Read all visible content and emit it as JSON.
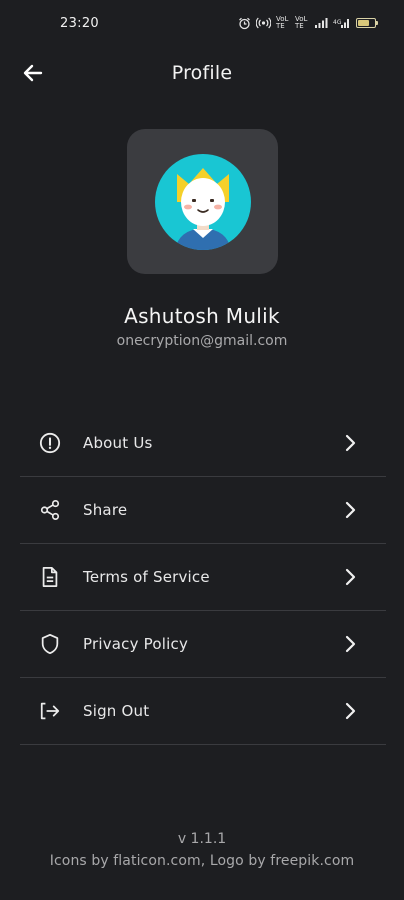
{
  "status_bar": {
    "time": "23:20",
    "icons": [
      "alarm-icon",
      "hotspot-icon",
      "volte-icon",
      "volte-icon",
      "signal-icon",
      "signal-icon",
      "battery-icon"
    ],
    "volte_text": "VoLTE",
    "battery_percent": 70
  },
  "header": {
    "title": "Profile",
    "back_icon": "arrow-left-icon"
  },
  "profile": {
    "avatar_icon": "king-avatar",
    "name": "Ashutosh Mulik",
    "email": "onecryption@gmail.com"
  },
  "menu": {
    "items": [
      {
        "label": "About Us",
        "icon": "info-circle-icon"
      },
      {
        "label": "Share",
        "icon": "share-icon"
      },
      {
        "label": "Terms of Service",
        "icon": "document-icon"
      },
      {
        "label": "Privacy Policy",
        "icon": "shield-icon"
      },
      {
        "label": "Sign Out",
        "icon": "sign-out-icon"
      }
    ]
  },
  "footer": {
    "version": "v 1.1.1",
    "credits": "Icons by flaticon.com, Logo by freepik.com"
  },
  "colors": {
    "background": "#1d1e21",
    "avatar_card": "#3b3c40",
    "avatar_circle": "#19c6d3",
    "crown": "#f5d02a",
    "divider": "#3a3b3f"
  }
}
